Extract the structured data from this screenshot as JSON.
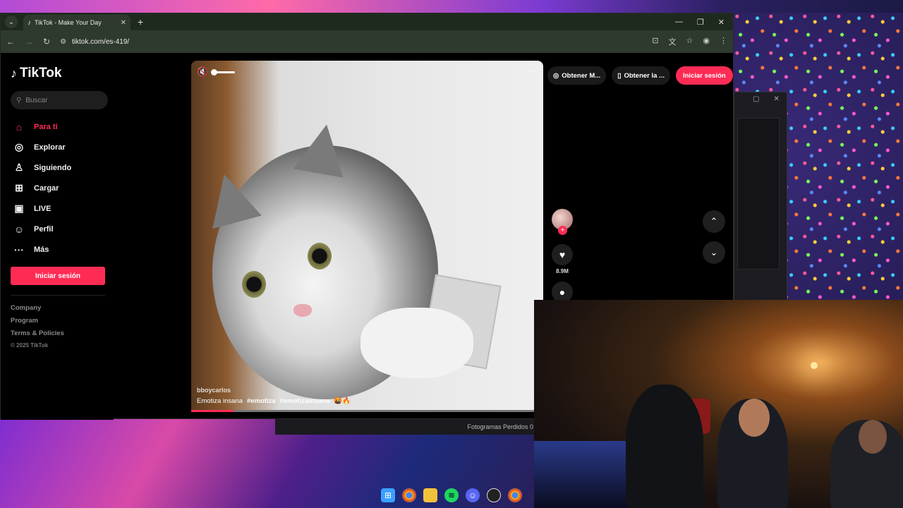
{
  "browser": {
    "tab_title": "TikTok - Make Your Day",
    "url": "tiktok.com/es-419/"
  },
  "sidebar": {
    "logo": "TikTok",
    "search_placeholder": "Buscar",
    "items": [
      {
        "label": "Para ti",
        "icon": "home-icon",
        "active": true
      },
      {
        "label": "Explorar",
        "icon": "compass-icon"
      },
      {
        "label": "Siguiendo",
        "icon": "following-icon"
      },
      {
        "label": "Cargar",
        "icon": "upload-icon"
      },
      {
        "label": "LIVE",
        "icon": "live-icon"
      },
      {
        "label": "Perfil",
        "icon": "profile-icon"
      },
      {
        "label": "Más",
        "icon": "more-icon"
      }
    ],
    "login_label": "Iniciar sesión",
    "footer": {
      "company": "Company",
      "program": "Program",
      "terms": "Terms & Policies",
      "copyright": "© 2025 TikTok"
    }
  },
  "video": {
    "author": "bboycarlos",
    "caption": "Emotiza insana",
    "hashtags": [
      "#emotiza",
      "#emotizainsana",
      "🤬🔥"
    ],
    "progress": 0.12
  },
  "top_actions": {
    "get_coins": "Obtener M...",
    "get_app": "Obtener la ...",
    "login": "Iniciar sesión"
  },
  "side_actions": {
    "likes": "8.9M"
  },
  "background_window": {
    "status_text": "Fotogramas Perdidos 0"
  },
  "colors": {
    "accent": "#fe2c55",
    "background": "#000000"
  }
}
